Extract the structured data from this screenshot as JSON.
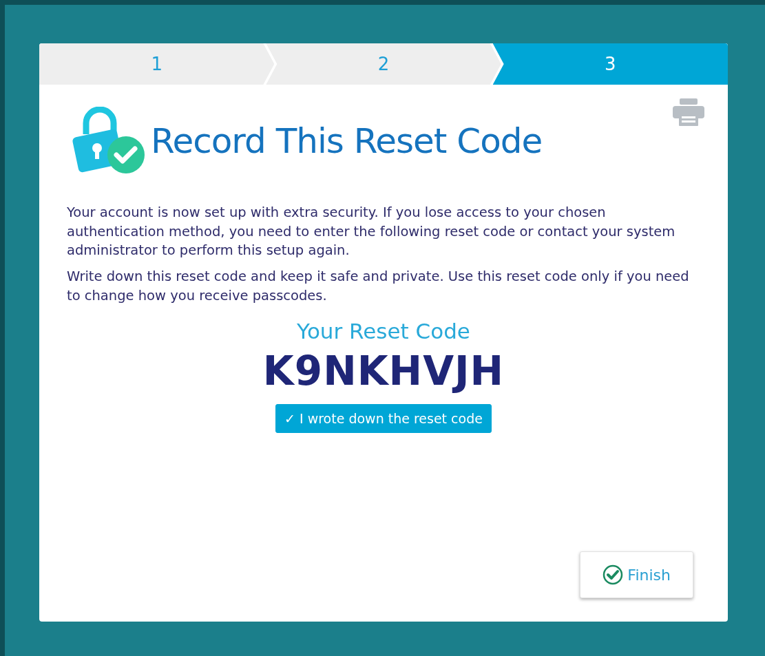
{
  "steps": [
    {
      "label": "1",
      "selected": false
    },
    {
      "label": "2",
      "selected": false
    },
    {
      "label": "3",
      "selected": true
    }
  ],
  "title": "Record This Reset Code",
  "paragraphs": [
    "Your account is now set up with extra security. If you lose access to your chosen authentication method, you need to enter the following reset code or contact your system administrator to perform this setup again.",
    "Write down this reset code and keep it safe and private. Use this reset code only if you need to change how you receive passcodes."
  ],
  "code_heading": "Your Reset Code",
  "reset_code": "K9NKHVJH",
  "confirm": {
    "mark": "✓",
    "label": "I wrote down the reset code",
    "checked": true
  },
  "finish_button": {
    "label": "Finish"
  }
}
